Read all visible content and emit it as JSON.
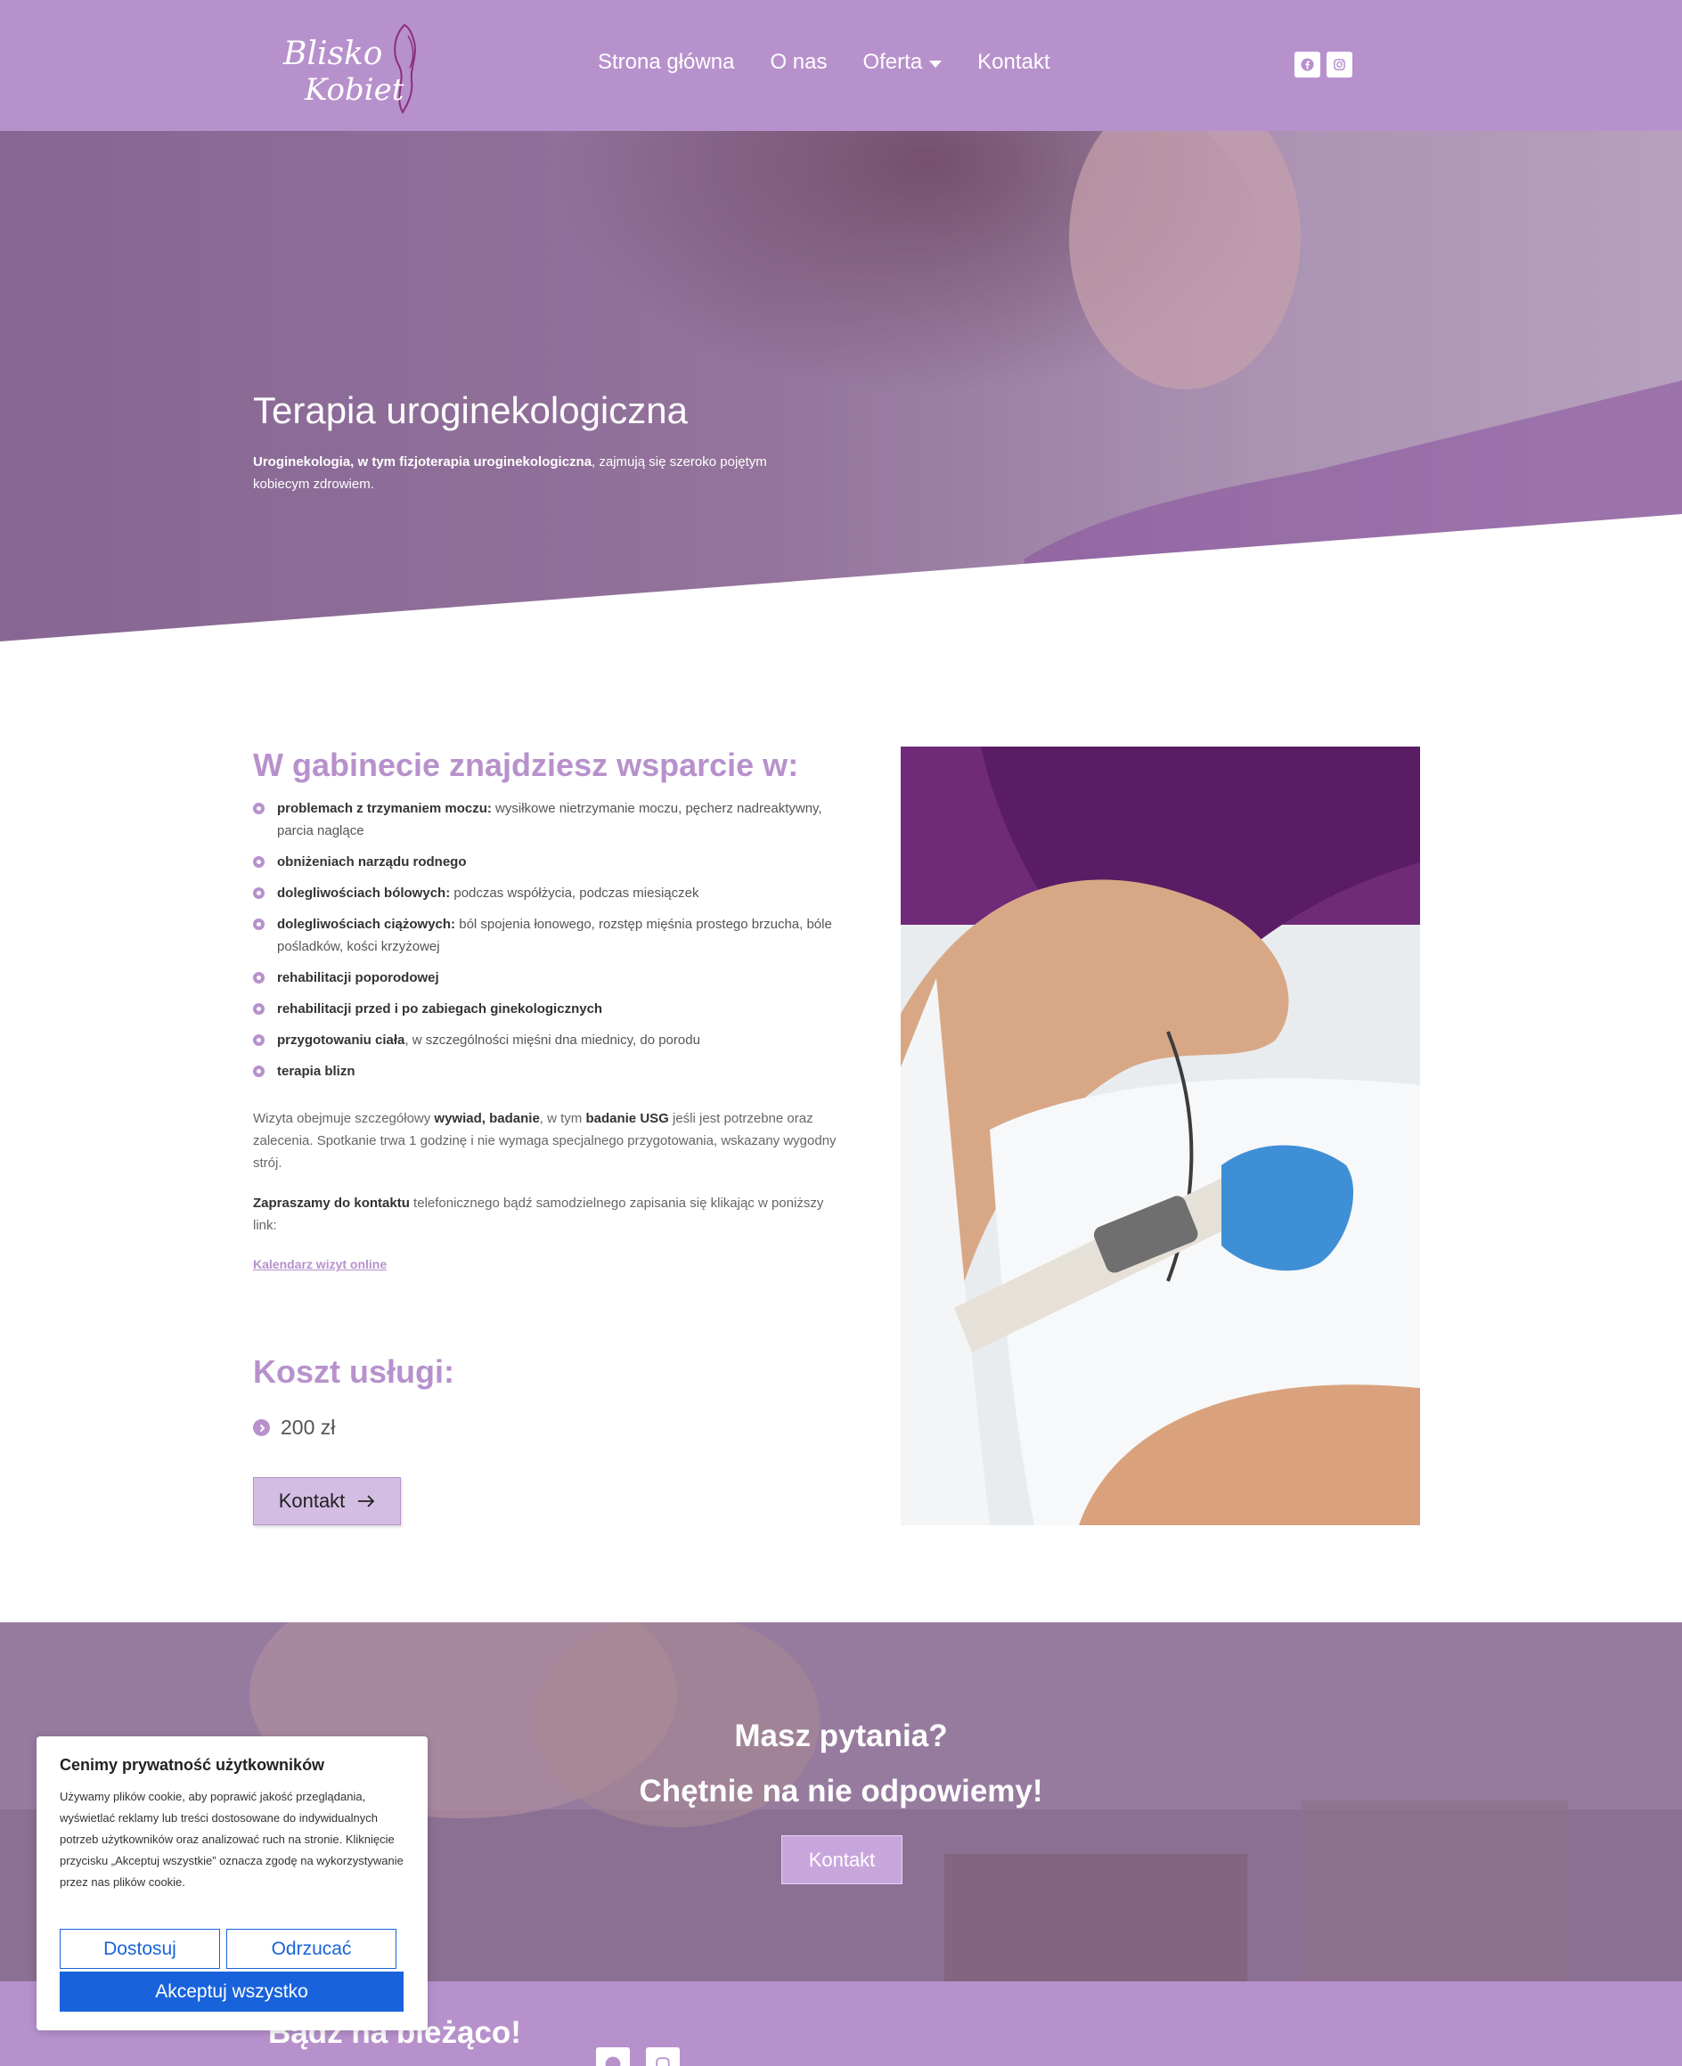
{
  "header": {
    "logo_text_line1": "Blisko",
    "logo_text_line2": "Kobiet",
    "nav": [
      {
        "label": "Strona główna"
      },
      {
        "label": "O nas"
      },
      {
        "label": "Oferta"
      },
      {
        "label": "Kontakt"
      }
    ],
    "social_icons": [
      "facebook-icon",
      "instagram-icon"
    ]
  },
  "hero": {
    "title": "Terapia uroginekologiczna",
    "subtitle_bold": "Uroginekologia, w tym fizjoterapia uroginekologiczna",
    "subtitle_rest": ", zajmują się szeroko pojętym kobiecym zdrowiem."
  },
  "support": {
    "heading": "W gabinecie znajdziesz wsparcie w:",
    "items": [
      {
        "bold": "problemach z trzymaniem moczu:",
        "text": " wysiłkowe nietrzymanie moczu, pęcherz nadreaktywny, parcia naglące"
      },
      {
        "bold": "obniżeniach narządu rodnego",
        "text": ""
      },
      {
        "bold": "dolegliwościach bólowych:",
        "text": " podczas współżycia, podczas miesiączek"
      },
      {
        "bold": "dolegliwościach ciążowych:",
        "text": " ból spojenia łonowego, rozstęp mięśnia prostego brzucha, bóle pośladków, kości krzyżowej"
      },
      {
        "bold": "rehabilitacji poporodowej",
        "text": ""
      },
      {
        "bold": "rehabilitacji przed i po zabiegach ginekologicznych",
        "text": ""
      },
      {
        "bold": "przygotowaniu ciała",
        "text": ", w szczególności mięśni dna miednicy, do porodu"
      },
      {
        "bold": "terapia blizn",
        "text": ""
      }
    ],
    "visit_p1": "Wizyta obejmuje szczegółowy ",
    "visit_b1": "wywiad, badanie",
    "visit_p2": ", w tym ",
    "visit_b2": "badanie USG",
    "visit_p3": " jeśli jest potrzebne oraz zalecenia. Spotkanie trwa 1 godzinę i nie wymaga specjalnego przygotowania, wskazany wygodny strój.",
    "invite_bold": "Zapraszamy do kontaktu",
    "invite_rest": " telefonicznego bądź samodzielnego zapisania się klikając w poniższy link:",
    "calendar_link": "Kalendarz wizyt online"
  },
  "pricing": {
    "heading": "Koszt usługi:",
    "price": "200 zł",
    "button_label": "Kontakt"
  },
  "cta": {
    "line1": "Masz pytania?",
    "line2": "Chętnie na nie odpowiemy!",
    "button_label": "Kontakt"
  },
  "footer": {
    "title": "Bądź na bieżąco!"
  },
  "cookie": {
    "title": "Cenimy prywatność użytkowników",
    "text": "Używamy plików cookie, aby poprawić jakość przeglądania, wyświetlać reklamy lub treści dostosowane do indywidualnych potrzeb użytkowników oraz analizować ruch na stronie. Kliknięcie przycisku „Akceptuj wszystkie” oznacza zgodę na wykorzystywanie przez nas plików cookie.",
    "customize": "Dostosuj",
    "reject": "Odrzucać",
    "accept": "Akceptuj wszystko"
  },
  "colors": {
    "brand": "#b791cc",
    "brand_light": "#d4bde3",
    "cookie_blue": "#1863dc"
  }
}
